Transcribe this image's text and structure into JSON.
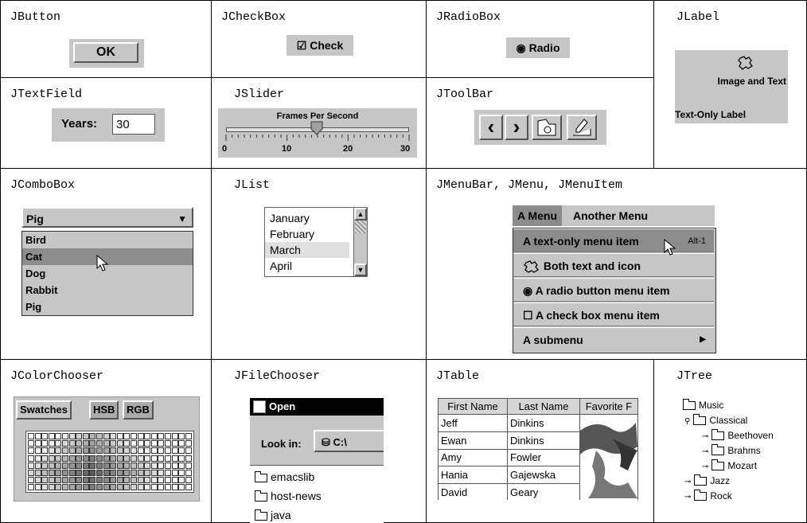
{
  "jbutton": {
    "title": "JButton",
    "label": "OK"
  },
  "jcheckbox": {
    "title": "JCheckBox",
    "mark": "☑",
    "label": "Check"
  },
  "jradiobox": {
    "title": "JRadioBox",
    "mark": "◉",
    "label": "Radio"
  },
  "jlabel": {
    "title": "JLabel",
    "image_text": "Image and Text",
    "text_only": "Text-Only Label"
  },
  "jtextfield": {
    "title": "JTextField",
    "label": "Years:",
    "value": "30"
  },
  "jslider": {
    "title": "JSlider",
    "label": "Frames Per Second",
    "value": 15,
    "min": 0,
    "max": 30,
    "ticks": [
      "0",
      "10",
      "20",
      "30"
    ]
  },
  "jtoolbar": {
    "title": "JToolBar",
    "buttons": [
      "‹",
      "›"
    ]
  },
  "jcombobox": {
    "title": "JComboBox",
    "selected": "Pig",
    "items": [
      "Bird",
      "Cat",
      "Dog",
      "Rabbit",
      "Pig"
    ]
  },
  "jlist": {
    "title": "JList",
    "items": [
      "January",
      "February",
      "March",
      "April"
    ]
  },
  "jmenu": {
    "title": "JMenuBar, JMenu, JMenuItem",
    "menus": [
      "A Menu",
      "Another Menu"
    ],
    "items": {
      "text_only": "A text-only menu item",
      "accelerator": "Alt-1",
      "both": "Both text and icon",
      "radio": "A radio button menu item",
      "check": "A check box menu item",
      "submenu": "A submenu"
    }
  },
  "jcolorchooser": {
    "title": "JColorChooser",
    "tabs": [
      "Swatches",
      "HSB",
      "RGB"
    ]
  },
  "jfilechooser": {
    "title": "JFileChooser",
    "dialog": "Open",
    "look_in": "Look in:",
    "drive": "C:\\",
    "entries": [
      "emacslib",
      "host-news",
      "java"
    ]
  },
  "jtable": {
    "title": "JTable",
    "columns": [
      "First Name",
      "Last Name",
      "Favorite F"
    ],
    "rows": [
      [
        "Jeff",
        "Dinkins"
      ],
      [
        "Ewan",
        "Dinkins"
      ],
      [
        "Amy",
        "Fowler"
      ],
      [
        "Hania",
        "Gajewska"
      ],
      [
        "David",
        "Geary"
      ]
    ]
  },
  "jtree": {
    "title": "JTree",
    "root": "Music",
    "classical": "Classical",
    "composers": [
      "Beethoven",
      "Brahms",
      "Mozart"
    ],
    "jazz": "Jazz",
    "rock": "Rock"
  }
}
